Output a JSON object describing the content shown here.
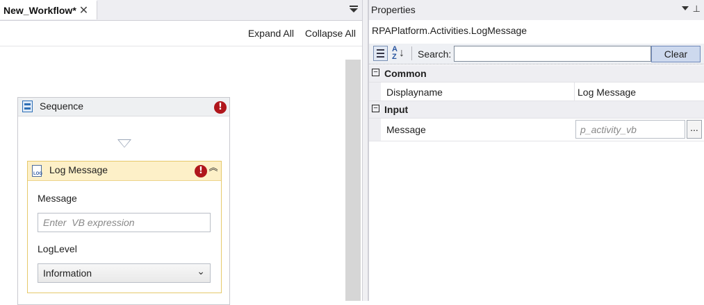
{
  "designer": {
    "tab_title": "New_Workflow*",
    "tab_close": "✕",
    "expand_all": "Expand All",
    "collapse_all": "Collapse All",
    "sequence": {
      "title": "Sequence",
      "error_glyph": "!"
    },
    "log_message": {
      "title": "Log Message",
      "icon_text": "LOG",
      "error_glyph": "!",
      "collapse_glyph": "︽",
      "message_label": "Message",
      "message_placeholder": "Enter  VB expression",
      "loglevel_label": "LogLevel",
      "loglevel_value": "Information",
      "loglevel_chevron": "⌄"
    }
  },
  "properties": {
    "title": "Properties",
    "pin_glyph": "⊥",
    "type_name": "RPAPlatform.Activities.LogMessage",
    "search_label": "Search:",
    "search_value": "",
    "clear_label": "Clear",
    "alpha_a": "A",
    "alpha_z": "Z",
    "alpha_arrow": "↓",
    "categories": [
      {
        "toggle": "−",
        "name": "Common",
        "rows": [
          {
            "name": "Displayname",
            "value": "Log Message"
          }
        ]
      },
      {
        "toggle": "−",
        "name": "Input",
        "rows": [
          {
            "name": "Message",
            "placeholder": "p_activity_vb",
            "button": "..."
          }
        ]
      }
    ]
  },
  "colors": {
    "error_red": "#b0161c",
    "log_header": "#fdf0c8",
    "accent_blue": "#2d6fb6"
  },
  "icons": [
    "close-icon",
    "dropdown-menu-icon",
    "sequence-icon",
    "error-icon",
    "log-icon",
    "collapse-icon",
    "chevron-down-icon",
    "pin-icon",
    "categorized-icon",
    "sort-alpha-icon"
  ]
}
